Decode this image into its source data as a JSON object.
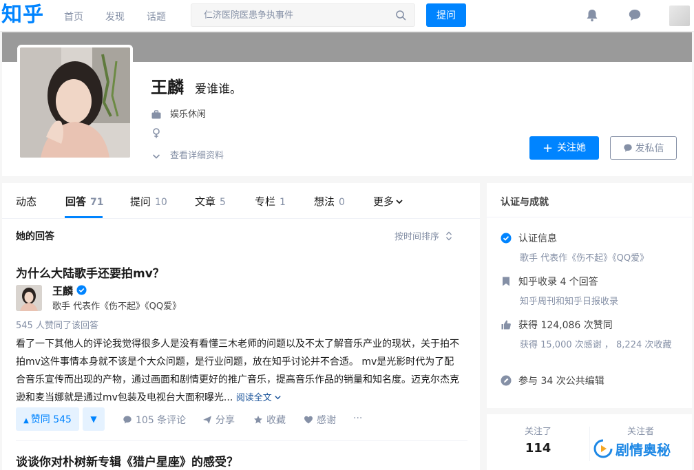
{
  "header": {
    "logo": "知乎",
    "nav": [
      "首页",
      "发现",
      "话题"
    ],
    "search_placeholder": "仁济医院医患争执事件",
    "ask_label": "提问"
  },
  "profile": {
    "name": "王麟",
    "headline": "爱谁谁。",
    "industry": "娱乐休闲",
    "view_details": "查看详细资料",
    "follow_label": "关注她",
    "message_label": "发私信"
  },
  "tabs": [
    {
      "label": "动态",
      "count": ""
    },
    {
      "label": "回答",
      "count": "71"
    },
    {
      "label": "提问",
      "count": "10"
    },
    {
      "label": "文章",
      "count": "5"
    },
    {
      "label": "专栏",
      "count": "1"
    },
    {
      "label": "想法",
      "count": "0"
    },
    {
      "label": "更多",
      "count": ""
    }
  ],
  "answers_section": {
    "title": "她的回答",
    "sort_label": "按时间排序"
  },
  "answer": {
    "question": "为什么大陆歌手还要拍mv？",
    "author_name": "王麟",
    "author_bio": "歌手 代表作《伤不起》《QQ爱》",
    "votes_text": "545 人赞同了该回答",
    "excerpt": "看了一下其他人的评论我觉得很多人是没有看懂三木老师的问题以及不太了解音乐产业的现状，关于拍不拍mv这件事情本身就不该是个大众问题，是行业问题，放在知乎讨论并不合适。 mv是光影时代为了配合音乐宣传而出现的产物，通过画面和剧情更好的推广音乐，提高音乐作品的销量和知名度。迈克尔杰克逊和麦当娜就是通过mv包装及电视台大面积曝光...",
    "read_more": "阅读全文",
    "vote_label": "赞同 545",
    "comments": "105 条评论",
    "share": "分享",
    "collect": "收藏",
    "thanks": "感谢",
    "more": "···"
  },
  "next_question": "谈谈你对朴树新专辑《猎户星座》的感受？",
  "sidebar": {
    "title": "认证与成就",
    "verified_title": "认证信息",
    "verified_detail": "歌手 代表作《伤不起》《QQ爱》",
    "collected_title": "知乎收录 4 个回答",
    "collected_detail": "知乎周刊和知乎日报收录",
    "likes_title": "获得 124,086 次赞同",
    "likes_detail": "获得 15,000 次感谢 ， 8,224 次收藏",
    "edits_title": "参与 34 次公共编辑"
  },
  "follow_stats": {
    "following_label": "关注了",
    "following_count": "114",
    "followers_label": "关注者"
  },
  "watermark": "剧情奥秘",
  "colors": {
    "brand": "#0084ff",
    "muted": "#8590a6",
    "cover": "#9a9a9a"
  }
}
